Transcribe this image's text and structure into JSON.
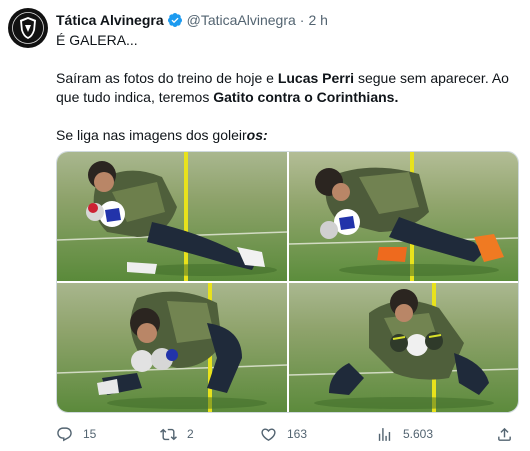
{
  "tweet": {
    "display_name": "Tática Alvinegra",
    "handle": "@TaticaAlvinegra",
    "separator": "·",
    "time": "2 h",
    "verified_icon": "verified-badge-icon",
    "text": {
      "line1": "É GALERA...",
      "p2_a": "Saíram as fotos do treino de hoje e ",
      "p2_b": "Lucas Perri",
      "p2_c": " segue sem aparecer. Ao que tudo indica, teremos ",
      "p2_d": "Gatito contra o Corinthians.",
      "p3_a": "Se liga nas imagens dos goleir",
      "p3_b": "os:"
    }
  },
  "media": {
    "photos": [
      {
        "icon": "goalkeeper-training-photo"
      },
      {
        "icon": "goalkeeper-training-photo"
      },
      {
        "icon": "goalkeeper-training-photo"
      },
      {
        "icon": "goalkeeper-training-photo"
      }
    ]
  },
  "actions": {
    "reply_count": "15",
    "retweet_count": "2",
    "like_count": "163",
    "views_count": "5.603"
  },
  "colors": {
    "text": "#0f1419",
    "muted": "#536471",
    "verified": "#1d9bf0",
    "grass": "#5f8a3f",
    "pole": "#e8e21c"
  }
}
